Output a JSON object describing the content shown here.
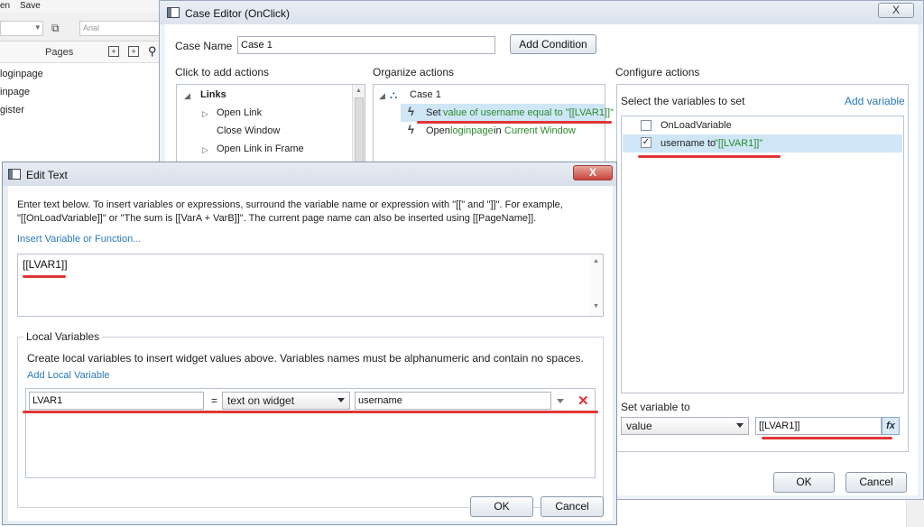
{
  "background_app": {
    "menu": [
      "en",
      "Save"
    ],
    "font_field": "Arial",
    "pages_label": "Pages",
    "pages": [
      "loginpage",
      "inpage",
      "gister"
    ]
  },
  "case_editor": {
    "title": "Case Editor (OnClick)",
    "close": "X",
    "case_name_label": "Case Name",
    "case_name_value": "Case 1",
    "add_condition": "Add Condition",
    "col_add_actions": "Click to add actions",
    "col_organize": "Organize actions",
    "col_configure": "Configure actions",
    "actions_tree": {
      "group": "Links",
      "items": [
        "Open Link",
        "Close Window",
        "Open Link in Frame"
      ]
    },
    "organize": {
      "case": "Case 1",
      "actions": [
        {
          "verb": "Set",
          "detail": "value of username equal to \"[[LVAR1]]\""
        },
        {
          "verb": "Open",
          "target": "loginpage",
          "mid": "in",
          "where": "Current Window"
        }
      ]
    },
    "configure": {
      "select_vars_label": "Select the variables to set",
      "add_variable": "Add variable",
      "variables": [
        {
          "name": "OnLoadVariable",
          "checked": false
        },
        {
          "name": "username to",
          "value": "\"[[LVAR1]]\"",
          "checked": true
        }
      ],
      "set_variable_to": "Set variable to",
      "value_type": "value",
      "value": "[[LVAR1]]",
      "fx": "fx"
    },
    "ok": "OK",
    "cancel": "Cancel"
  },
  "edit_text": {
    "title": "Edit Text",
    "close": "X",
    "instructions_line1": "Enter text below. To insert variables or expressions, surround the variable name or expression with \"[[\" and \"]]\". For example,",
    "instructions_line2": "\"[[OnLoadVariable]]\" or \"The sum is [[VarA + VarB]]\". The current page name can also be inserted using [[PageName]].",
    "insert_link": "Insert Variable or Function...",
    "text_value": "[[LVAR1]]",
    "local_vars_title": "Local Variables",
    "local_vars_desc": "Create local variables to insert widget values above. Variables names must be alphanumeric and contain no spaces.",
    "add_local_variable": "Add Local Variable",
    "local_var": {
      "name": "LVAR1",
      "equals": "=",
      "type": "text on widget",
      "widget": "username"
    },
    "ok": "OK",
    "cancel": "Cancel"
  },
  "colors": {
    "annotation": "#e03636",
    "link": "#2a7ab8",
    "green_text": "#2a8a2a",
    "selection": "#cfe6f7"
  }
}
